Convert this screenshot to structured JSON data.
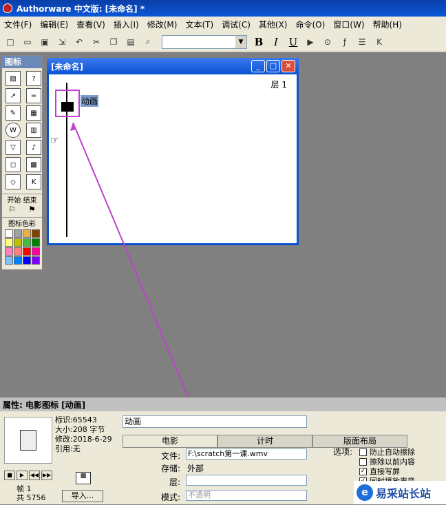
{
  "app": {
    "title": "Authorware 中文版: [未命名] *"
  },
  "menu": [
    "文件(F)",
    "编辑(E)",
    "查看(V)",
    "插入(I)",
    "修改(M)",
    "文本(T)",
    "调试(C)",
    "其他(X)",
    "命令(O)",
    "窗口(W)",
    "帮助(H)"
  ],
  "toolbar": {
    "bold": "B",
    "italic": "I",
    "underline": "U"
  },
  "palette": {
    "title": "图标",
    "start_end": "开始 结束",
    "color_label": "图标色彩",
    "icons": [
      "display-icon",
      "interaction-icon",
      "motion-icon",
      "calculation-icon",
      "erase-icon",
      "map-icon",
      "wait-icon",
      "digital-movie-icon",
      "navigate-icon",
      "sound-icon",
      "framework-icon",
      "video-icon",
      "decision-icon",
      "knowledge-object-icon"
    ],
    "colors": [
      "#ffffff",
      "#a0a0a0",
      "#f0b040",
      "#804000",
      "#ffff80",
      "#c0c000",
      "#40c040",
      "#008000",
      "#ff80c0",
      "#ff8080",
      "#ff0000",
      "#ff00a0",
      "#80c0ff",
      "#0080ff",
      "#0000ff",
      "#8000ff"
    ]
  },
  "flowwin": {
    "title": "[未命名]",
    "layer": "层 1",
    "icon_label": "动画"
  },
  "props": {
    "title": "属性: 电影图标 [动画]",
    "info": [
      "标识:65543",
      "大小:208 字节",
      "修改:2018-6-29",
      "引用:无"
    ],
    "frame": "帧 1",
    "total": "共 5756",
    "import": "导入...",
    "name": "动画",
    "tabs": [
      "电影",
      "计时",
      "版面布局"
    ],
    "file_label": "文件:",
    "file_value": "F:\\scratch第一课.wmv",
    "storage_label": "存储:",
    "storage_value": "外部",
    "layer_label": "层:",
    "mode_label": "模式:",
    "mode_value": "不透明",
    "options_label": "选项:",
    "options": [
      {
        "label": "防止自动擦除",
        "checked": false
      },
      {
        "label": "擦除以前内容",
        "checked": false
      },
      {
        "label": "直接写屏",
        "checked": true
      },
      {
        "label": "同时播放声音",
        "checked": true
      }
    ]
  },
  "logo": {
    "text": "易采站长站"
  }
}
